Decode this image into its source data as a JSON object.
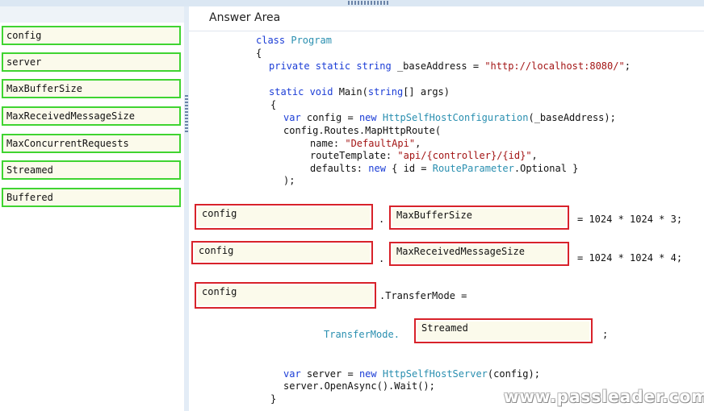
{
  "answer_area": {
    "title": "Answer Area"
  },
  "source_items": [
    {
      "label": "config"
    },
    {
      "label": "server"
    },
    {
      "label": "MaxBufferSize"
    },
    {
      "label": "MaxReceivedMessageSize"
    },
    {
      "label": "MaxConcurrentRequests"
    },
    {
      "label": "Streamed"
    },
    {
      "label": "Buffered"
    }
  ],
  "code": {
    "l1": {
      "kw": "class",
      "ty": "Program"
    },
    "l2": "{",
    "l3": {
      "kw": "private static string",
      "rest": " _baseAddress = ",
      "str": "\"http://localhost:8080/\"",
      "end": ";"
    },
    "l4": {
      "kw": "static void",
      "rest": " Main(",
      "kw2": "string",
      "rest2": "[] args)"
    },
    "l5": "{",
    "l6": {
      "kw": "var",
      "a": " config = ",
      "kw2": "new",
      "sp": " ",
      "ty": "HttpSelfHostConfiguration",
      "b": "(_baseAddress);"
    },
    "l7": "config.Routes.MapHttpRoute(",
    "l8": {
      "a": "name: ",
      "str": "\"DefaultApi\"",
      "b": ","
    },
    "l9": {
      "a": "routeTemplate: ",
      "str": "\"api/{controller}/{id}\"",
      "b": ","
    },
    "l10": {
      "a": "defaults: ",
      "kw": "new",
      "b": " { id = ",
      "ty": "RouteParameter",
      "c": ".Optional }"
    },
    "l11": ");",
    "dot": ".",
    "assign1": "= 1024 * 1024 * 3;",
    "assign2": "= 1024 * 1024 * 4;",
    "transfer_mode": ".TransferMode =",
    "transfer_type": "TransferMode.",
    "semi": ";",
    "l12": {
      "kw": "var",
      "a": " server = ",
      "kw2": "new",
      "sp": " ",
      "ty": "HttpSelfHostServer",
      "b": "(config);"
    },
    "l13": "server.OpenAsync().Wait();",
    "l14": "}"
  },
  "slots": {
    "s1": "config",
    "s2": "MaxBufferSize",
    "s3": "config",
    "s4": "MaxReceivedMessageSize",
    "s5": "config",
    "s6": "Streamed"
  },
  "watermark": "www.passleader.com",
  "colors": {
    "source_border": "#3fd431",
    "slot_border": "#d8222a",
    "keyword": "#1a3cd6",
    "type": "#2a8fb0",
    "string": "#a31515"
  }
}
